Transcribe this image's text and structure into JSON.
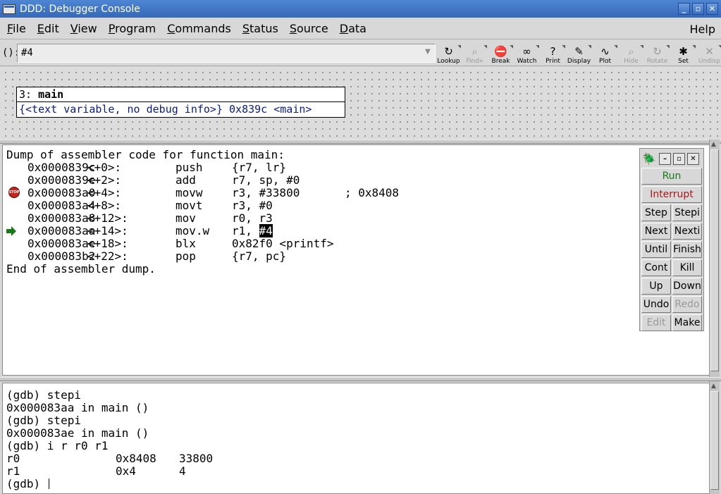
{
  "window": {
    "title": "DDD: Debugger Console",
    "controls": [
      "_",
      "▫",
      "✕"
    ]
  },
  "menubar": {
    "items": [
      {
        "u": "F",
        "rest": "ile"
      },
      {
        "u": "E",
        "rest": "dit"
      },
      {
        "u": "V",
        "rest": "iew"
      },
      {
        "u": "P",
        "rest": "rogram"
      },
      {
        "u": "C",
        "rest": "ommands"
      },
      {
        "u": "S",
        "rest": "tatus"
      },
      {
        "u": "S",
        "rest": "ource"
      },
      {
        "u": "D",
        "rest": "ata"
      }
    ],
    "help": {
      "u": "H",
      "rest": "elp"
    }
  },
  "toolbar": {
    "arg_label": "():",
    "arg_value": "#4",
    "tools": [
      {
        "label": "Lookup",
        "icon": "↻",
        "disabled": false
      },
      {
        "label": "Find»",
        "icon": "⌕",
        "disabled": true
      },
      {
        "label": "Break",
        "icon": "⛔",
        "disabled": false
      },
      {
        "label": "Watch",
        "icon": "∞",
        "disabled": false
      },
      {
        "label": "Print",
        "icon": "?",
        "disabled": false
      },
      {
        "label": "Display",
        "icon": "✎",
        "disabled": false
      },
      {
        "label": "Plot",
        "icon": "∿",
        "disabled": false
      },
      {
        "label": "Hide",
        "icon": "⌕",
        "disabled": true
      },
      {
        "label": "Rotate",
        "icon": "↻",
        "disabled": true
      },
      {
        "label": "Set",
        "icon": "✱",
        "disabled": false
      },
      {
        "label": "Undisp",
        "icon": "✕",
        "disabled": true
      }
    ]
  },
  "data_display": {
    "number": "3:",
    "name": "main",
    "value": "{<text variable, no debug info>} 0x839c <main>"
  },
  "assembler": {
    "header": "Dump of assembler code for function main:",
    "footer": "End of assembler dump.",
    "lines": [
      {
        "addr": "0x0000839c",
        "off": "<+0>:",
        "op": "push",
        "args": "{r7, lr}",
        "comment": "",
        "marker": ""
      },
      {
        "addr": "0x0000839e",
        "off": "<+2>:",
        "op": "add",
        "args": "r7, sp, #0",
        "comment": "",
        "marker": ""
      },
      {
        "addr": "0x000083a0",
        "off": "<+4>:",
        "op": "movw",
        "args": "r3, #33800",
        "comment": "; 0x8408",
        "marker": "stop"
      },
      {
        "addr": "0x000083a4",
        "off": "<+8>:",
        "op": "movt",
        "args": "r3, #0",
        "comment": "",
        "marker": ""
      },
      {
        "addr": "0x000083a8",
        "off": "<+12>:",
        "op": "mov",
        "args": "r0, r3",
        "comment": "",
        "marker": ""
      },
      {
        "addr": "0x000083aa",
        "off": "<+14>:",
        "op": "mov.w",
        "args": "r1, ",
        "args_hl": "#4",
        "comment": "",
        "marker": "exec"
      },
      {
        "addr": "0x000083ae",
        "off": "<+18>:",
        "op": "blx",
        "args": "0x82f0 <printf>",
        "comment": "",
        "marker": ""
      },
      {
        "addr": "0x000083b2",
        "off": "<+22>:",
        "op": "pop",
        "args": "{r7, pc}",
        "comment": "",
        "marker": ""
      }
    ],
    "stop_icon_text": "STOP"
  },
  "command_tool": {
    "run": "Run",
    "interrupt": "Interrupt",
    "pairs": [
      [
        "Step",
        "Stepi"
      ],
      [
        "Next",
        "Nexti"
      ],
      [
        "Until",
        "Finish"
      ],
      [
        "Cont",
        "Kill"
      ],
      [
        "Up",
        "Down"
      ],
      [
        "Undo",
        "Redo"
      ],
      [
        "Edit",
        "Make"
      ]
    ],
    "disabled": [
      "Redo",
      "Edit"
    ]
  },
  "console": {
    "lines": [
      {
        "text": "(gdb) stepi"
      },
      {
        "text": "0x000083aa in main ()"
      },
      {
        "text": "(gdb) stepi"
      },
      {
        "text": "0x000083ae in main ()"
      },
      {
        "text": "(gdb) i r r0 r1"
      },
      {
        "text": "r0",
        "c2": "0x8408",
        "c3": "33800"
      },
      {
        "text": "r1",
        "c2": "0x4",
        "c3": "4"
      },
      {
        "text": "(gdb) ",
        "cursor": true
      }
    ]
  },
  "colors": {
    "titlebar": "#3569b8",
    "run": "#1a7a1a",
    "interrupt": "#a81818",
    "data_value": "#0a1a8a",
    "stop": "#c0281e",
    "exec_arrow": "#1a7a1a"
  }
}
